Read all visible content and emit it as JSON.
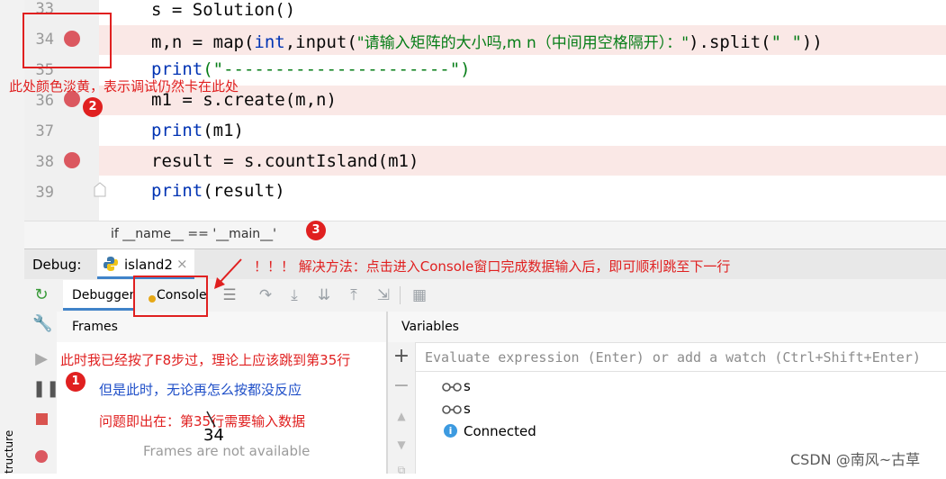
{
  "editor": {
    "lines": [
      {
        "num": "33",
        "text": "s = Solution()"
      },
      {
        "num": "34",
        "kw1": "m,n = map(",
        "kw2": "int",
        "kw3": ",input(",
        "str": "\"请输入矩阵的大小吗,m n（中间用空格隔开）：\"",
        "rest": ").split(",
        "str2": "\" \"",
        "end": "))"
      },
      {
        "num": "35",
        "kw": "print",
        "str": "(\"----------------------\")"
      },
      {
        "num": "36",
        "text": "m1 = s.create(m,n)"
      },
      {
        "num": "37",
        "kw": "print",
        "rest": "(m1)"
      },
      {
        "num": "38",
        "text": "result = s.countIsland(m1)"
      },
      {
        "num": "39",
        "kw": "print",
        "rest": "(result)"
      }
    ],
    "breadcrumb": "if __name__ == '__main__'"
  },
  "debug": {
    "title": "Debug:",
    "session_tab": "island2",
    "session_close": "×",
    "tabs": {
      "debugger": "Debugger",
      "console": "Console"
    },
    "frames_title": "Frames",
    "frames_empty": "Frames are not available",
    "variables_title": "Variables",
    "watch_placeholder": "Evaluate expression (Enter) or add a watch (Ctrl+Shift+Enter)",
    "variables": [
      {
        "name": "s",
        "icon": "watch-glasses-icon"
      },
      {
        "name": "s",
        "icon": "watch-glasses-icon"
      },
      {
        "name": "Connected",
        "icon": "info-icon"
      }
    ]
  },
  "structure_label": "tructure",
  "annotations": {
    "note_color": "此处颜色淡黄，表示调试仍然卡在此处",
    "solution": "！！！ 解决方法：点击进入Console窗口完成数据输入后，即可顺利跳至下一行",
    "f8_note": "此时我已经按了F8步过，理论上应该跳到第35行",
    "no_response": "但是此时，无论再怎么按都没反应",
    "problem": "问题即出在：第35行需要输入数据",
    "handwritten": "34",
    "circle1": "1",
    "circle2": "2",
    "circle3": "3"
  },
  "watermark": "CSDN @南风~古草",
  "colors": {
    "breakpoint": "#db5860",
    "highlight": "#fae8e6",
    "annotation": "#e02020",
    "annotation_blue": "#1f4fc8",
    "tab_accent": "#4083c9"
  }
}
